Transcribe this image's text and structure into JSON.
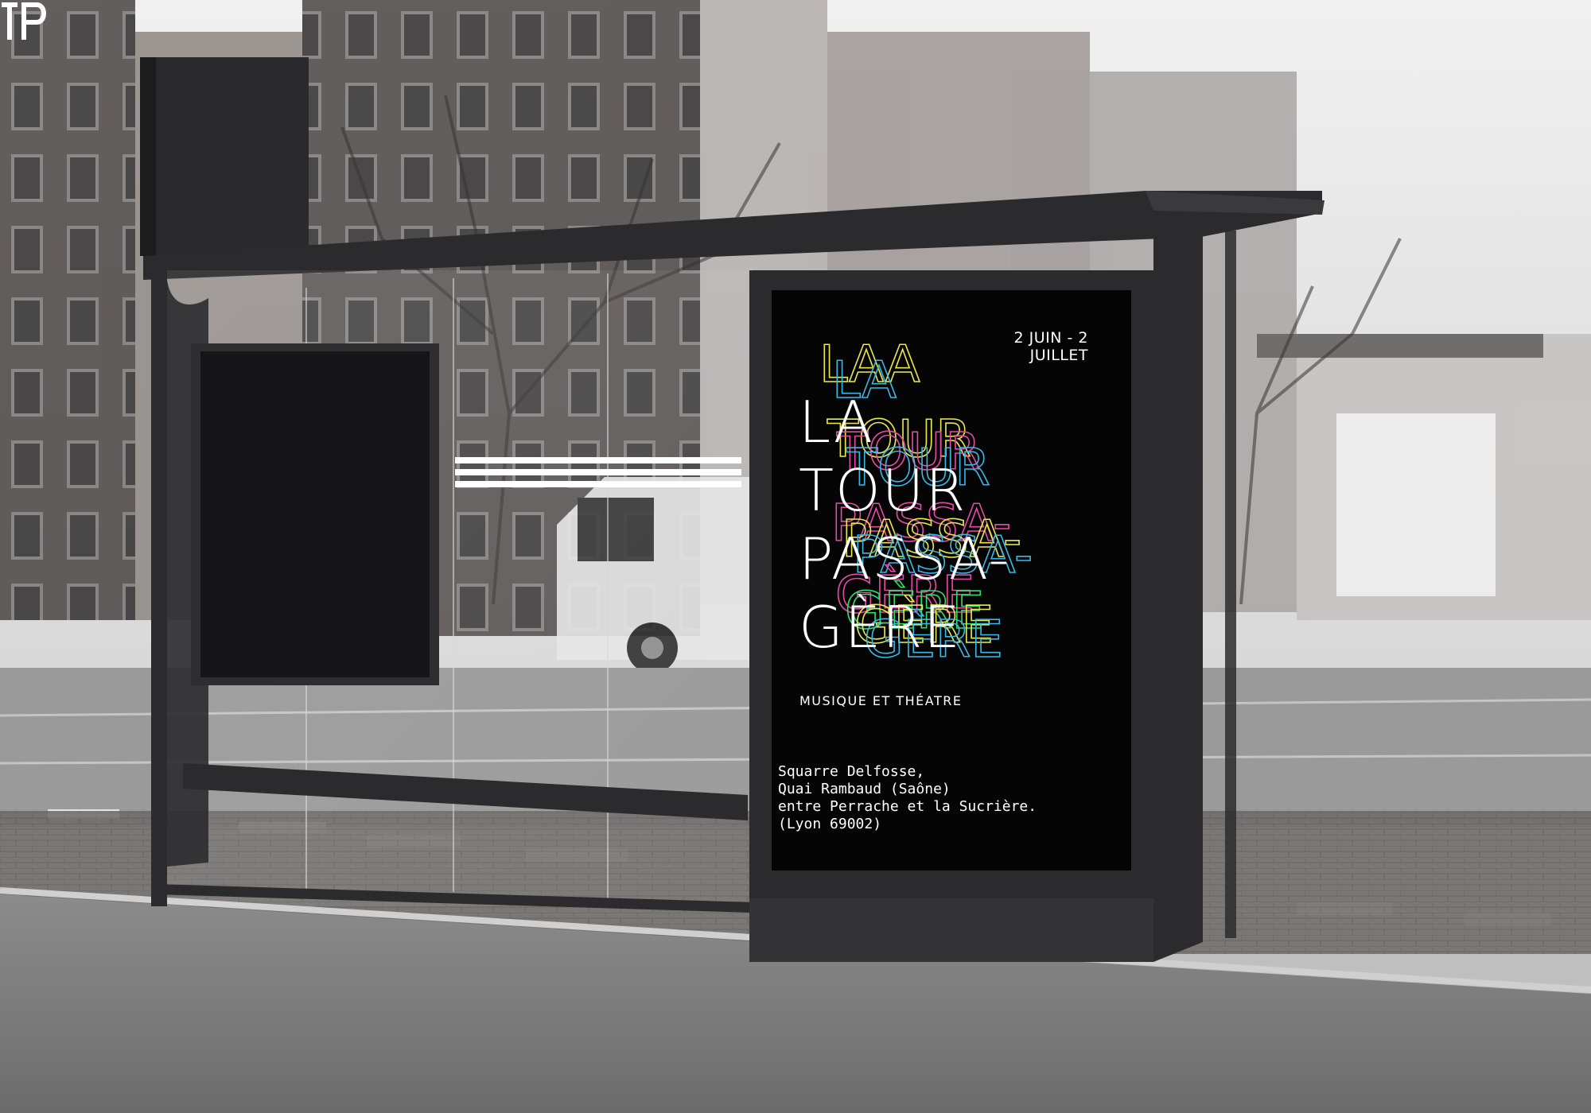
{
  "poster": {
    "dates": "2 JUIN - 2 JUILLET",
    "title_lines": [
      "LA",
      "TOUR",
      "PASSA-",
      "GÈRE"
    ],
    "subtitle": "MUSIQUE ET THÉATRE",
    "address_lines": [
      "Squarre Delfosse,",
      "Quai Rambaud (Saône)",
      "entre Perrache et la Sucrière.",
      "(Lyon 69002)"
    ],
    "logo_letters": "TP",
    "echo_colors": [
      "#e8e84a",
      "#39b9e8",
      "#e84aa6",
      "#ffffff",
      "#2ee06b"
    ]
  },
  "colors": {
    "shelter_frame": "#2b2b2d",
    "poster_bg": "#050505",
    "sky": "#e9e9e9"
  }
}
